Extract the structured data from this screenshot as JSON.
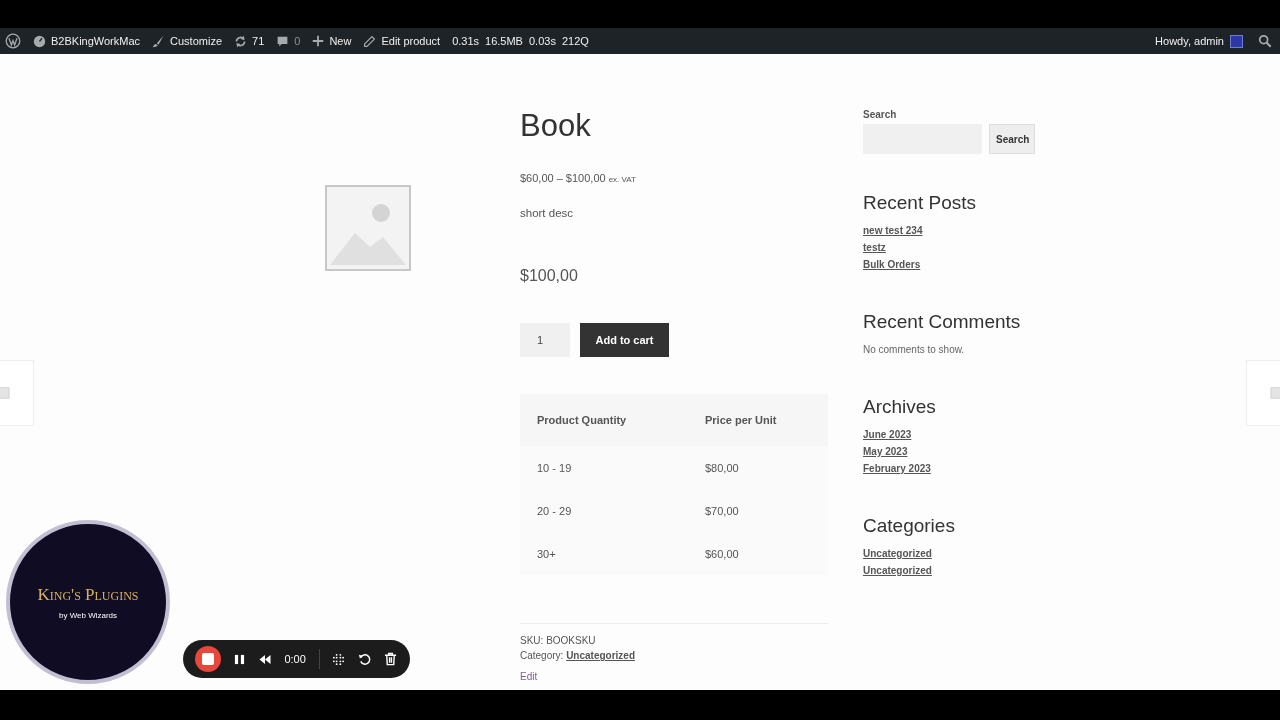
{
  "admin_bar": {
    "site": "B2BKingWorkMac",
    "customize": "Customize",
    "updates": "71",
    "comments": "0",
    "new": "New",
    "edit": "Edit product",
    "stats": [
      {
        "value": "0.31s"
      },
      {
        "value": "16.5MB"
      },
      {
        "value": "0.03s"
      },
      {
        "value": "212Q"
      }
    ],
    "greeting": "Howdy, admin"
  },
  "product": {
    "title": "Book",
    "price_range": "$60,00 – $100,00",
    "price_suffix": "ex. VAT",
    "short_description": "short desc",
    "price": "$100,00",
    "quantity": "1",
    "add_to_cart": "Add to cart",
    "tiers": {
      "columns": [
        "Product Quantity",
        "Price per Unit"
      ],
      "rows": [
        [
          "10 - 19",
          "$80,00"
        ],
        [
          "20 - 29",
          "$70,00"
        ],
        [
          "30+",
          "$60,00"
        ]
      ]
    },
    "sku_label": "SKU:",
    "sku": "BOOKSKU",
    "category_label": "Category:",
    "category": "Uncategorized",
    "edit_link": "Edit"
  },
  "sidebar": {
    "search_label": "Search",
    "search_button": "Search",
    "widgets": [
      {
        "title": "Recent Posts",
        "kind": "links",
        "items": [
          "new test 234",
          "testz",
          "Bulk Orders"
        ]
      },
      {
        "title": "Recent Comments",
        "kind": "text",
        "items": [
          "No comments to show."
        ]
      },
      {
        "title": "Archives",
        "kind": "links",
        "items": [
          "June 2023",
          "May 2023",
          "February 2023"
        ]
      },
      {
        "title": "Categories",
        "kind": "links",
        "items": [
          "Uncategorized",
          "Uncategorized"
        ]
      }
    ]
  },
  "logo": {
    "brand": "King's Plugins",
    "byline": "by Web Wizards"
  },
  "recorder": {
    "time": "0:00"
  }
}
